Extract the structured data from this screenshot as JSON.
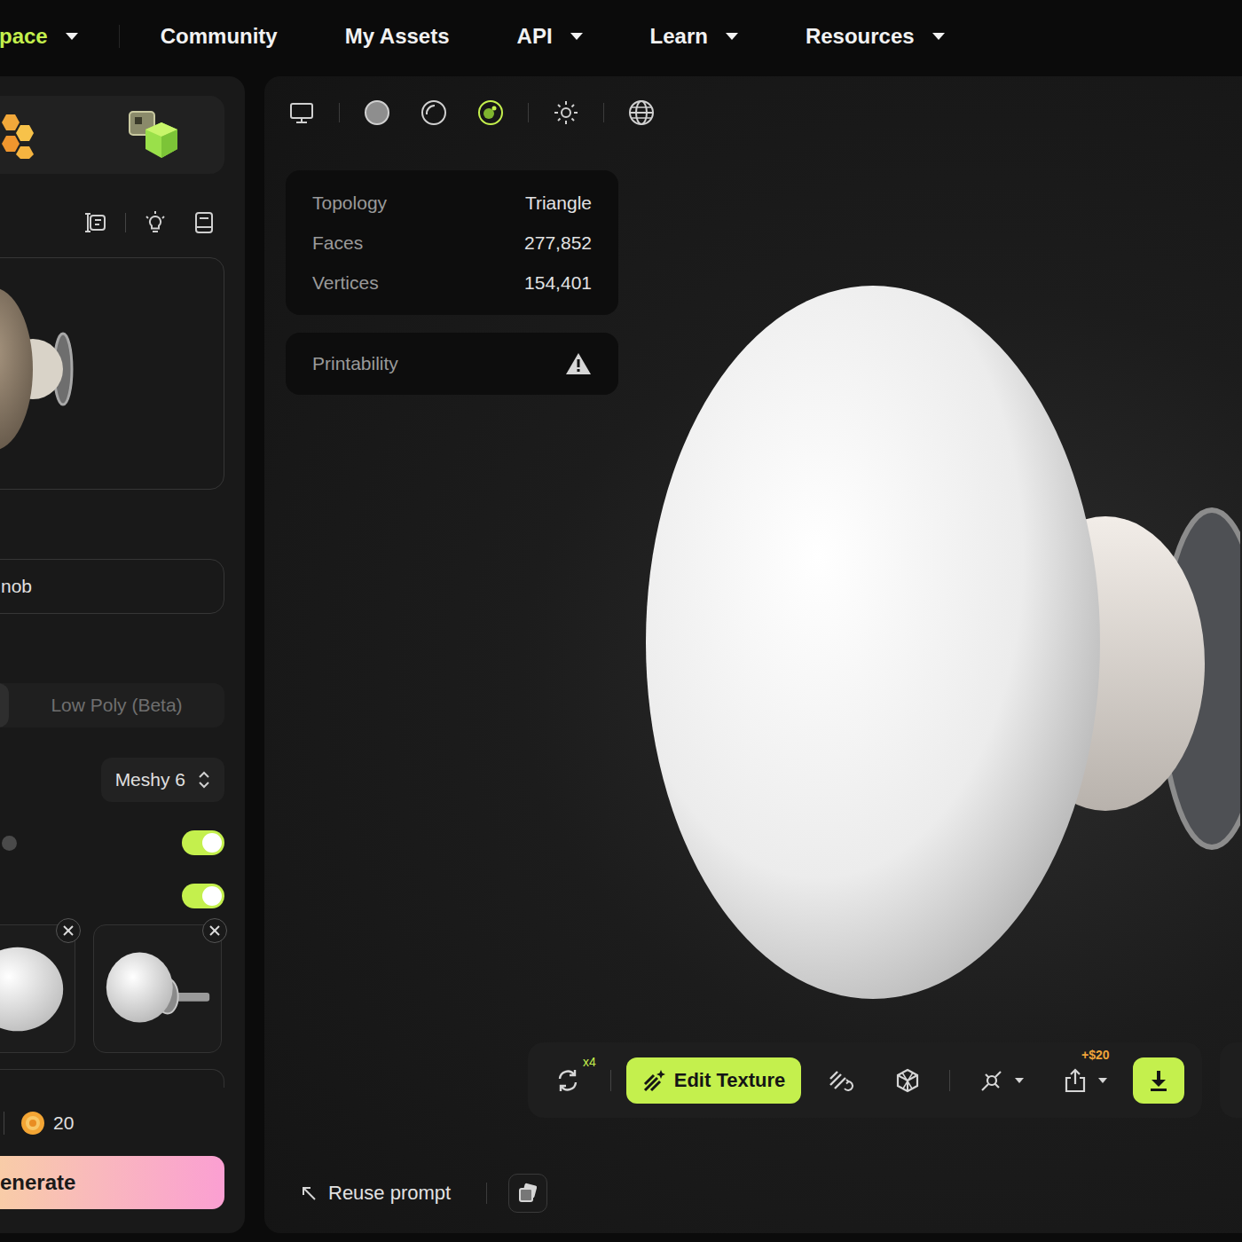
{
  "nav": {
    "items": [
      {
        "label": "pace",
        "selected": true,
        "dropdown": true
      },
      {
        "label": "Community",
        "selected": false,
        "dropdown": false
      },
      {
        "label": "My Assets",
        "selected": false,
        "dropdown": false
      },
      {
        "label": "API",
        "selected": false,
        "dropdown": true
      },
      {
        "label": "Learn",
        "selected": false,
        "dropdown": true
      },
      {
        "label": "Resources",
        "selected": false,
        "dropdown": true
      }
    ]
  },
  "left_panel": {
    "prompt_field": {
      "value": "nob"
    },
    "mode_tabs": [
      {
        "label": "",
        "selected": true
      },
      {
        "label": "Low Poly (Beta)",
        "selected": false
      }
    ],
    "model_select": {
      "value": "Meshy 6"
    },
    "toggles": [
      {
        "on": true,
        "info": true
      },
      {
        "on": true,
        "info": false
      }
    ],
    "reference_images": [
      {
        "kind": "egg",
        "removable": true
      },
      {
        "kind": "knob",
        "removable": true
      }
    ],
    "credits": "20",
    "generate_button": "enerate"
  },
  "viewport": {
    "shading_modes": [
      {
        "kind": "solid",
        "selected": false
      },
      {
        "kind": "clay",
        "selected": false
      },
      {
        "kind": "textured",
        "selected": true
      }
    ],
    "stats": [
      {
        "label": "Topology",
        "value": "Triangle"
      },
      {
        "label": "Faces",
        "value": "277,852"
      },
      {
        "label": "Vertices",
        "value": "154,401"
      }
    ],
    "printability": {
      "label": "Printability",
      "warning": true
    },
    "toolbar": {
      "regenerate_badge": "x4",
      "edit_texture": "Edit Texture",
      "share_badge": "+$20"
    },
    "reuse_prompt": "Reuse prompt"
  }
}
